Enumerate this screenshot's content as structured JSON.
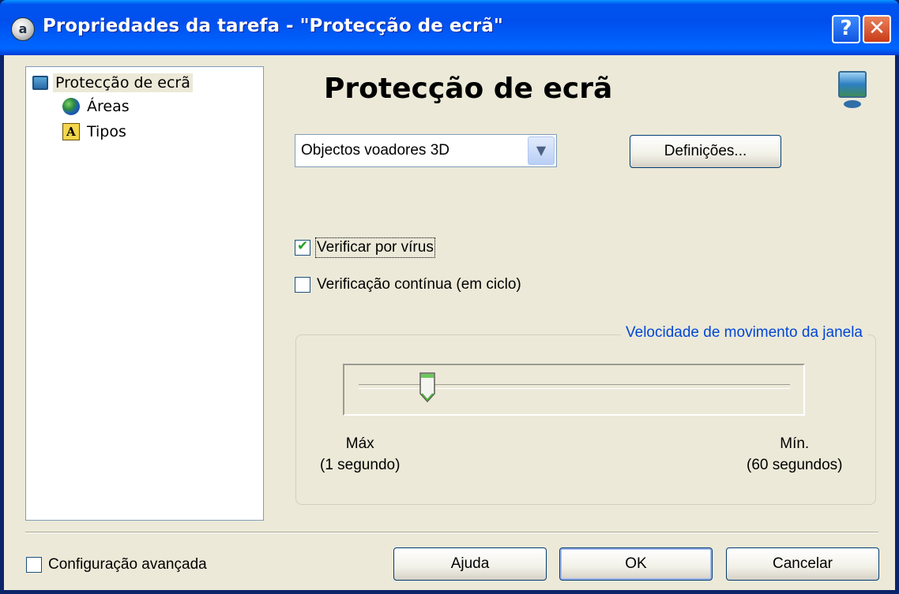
{
  "window": {
    "title": "Propriedades da tarefa - \"Protecção de ecrã\"",
    "help_glyph": "?",
    "close_glyph": "✕",
    "icon": "app-icon"
  },
  "tree": {
    "items": [
      {
        "label": "Protecção de ecrã",
        "icon": "screen-icon",
        "selected": true
      },
      {
        "label": "Áreas",
        "icon": "globe-icon",
        "selected": false
      },
      {
        "label": "Tipos",
        "icon": "font-icon",
        "selected": false
      }
    ]
  },
  "page": {
    "heading": "Protecção de ecrã",
    "combo_value": "Objectos voadores 3D",
    "settings_button": "Definições...",
    "scan_virus_label": "Verificar por vírus",
    "scan_virus_checked": true,
    "continuous_scan_label": "Verificação contínua (em ciclo)",
    "continuous_scan_checked": false
  },
  "speed": {
    "group_title": "Velocidade de movimento da janela",
    "min_label_line1": "Máx",
    "min_label_line2": "(1 segundo)",
    "max_label_line1": "Mín.",
    "max_label_line2": "(60 segundos)",
    "slider_value_fraction": 0.16
  },
  "footer": {
    "advanced_label": "Configuração avançada",
    "advanced_checked": false,
    "help_button": "Ajuda",
    "ok_button": "OK",
    "cancel_button": "Cancelar"
  }
}
